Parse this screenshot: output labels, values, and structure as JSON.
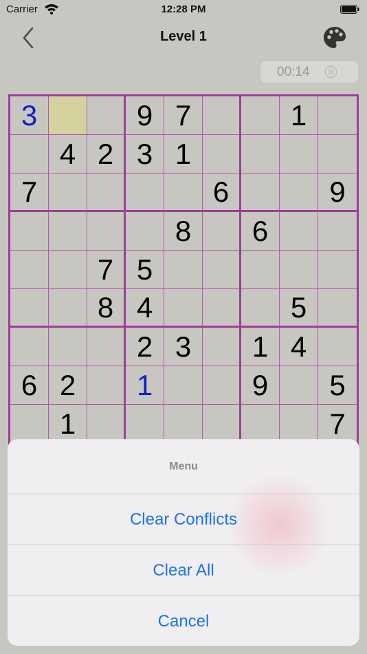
{
  "status_bar": {
    "carrier": "Carrier",
    "time": "12:28 PM"
  },
  "nav": {
    "title": "Level 1"
  },
  "timer": {
    "value": "00:14"
  },
  "board": {
    "rows": [
      [
        "3",
        "",
        "",
        "9",
        "7",
        "",
        "",
        "1",
        ""
      ],
      [
        "",
        "4",
        "2",
        "3",
        "1",
        "",
        "",
        "",
        ""
      ],
      [
        "7",
        "",
        "",
        "",
        "",
        "6",
        "",
        "",
        "9"
      ],
      [
        "",
        "",
        "",
        "",
        "8",
        "",
        "6",
        "",
        ""
      ],
      [
        "",
        "",
        "7",
        "5",
        "",
        "",
        "",
        "",
        ""
      ],
      [
        "",
        "",
        "8",
        "4",
        "",
        "",
        "",
        "5",
        ""
      ],
      [
        "",
        "",
        "",
        "2",
        "3",
        "",
        "1",
        "4",
        ""
      ],
      [
        "6",
        "2",
        "",
        "1",
        "",
        "",
        "9",
        "",
        "5"
      ],
      [
        "",
        "1",
        "",
        "",
        "",
        "",
        "",
        "",
        "7"
      ]
    ],
    "user_entries": [
      [
        0,
        0
      ],
      [
        7,
        3
      ]
    ],
    "selected": [
      0,
      1
    ]
  },
  "menu": {
    "title": "Menu",
    "clear_conflicts": "Clear Conflicts",
    "clear_all": "Clear All",
    "cancel": "Cancel"
  },
  "colors": {
    "accent": "#1a73e8",
    "grid": "#9c3f97",
    "user_digit": "#1020c8",
    "selected_cell": "#d4d29f",
    "background": "#c8c6c1"
  },
  "icons": {
    "back": "chevron-left-icon",
    "theme": "palette-icon",
    "pause": "pause-icon",
    "wifi": "wifi-icon",
    "battery": "battery-icon"
  }
}
